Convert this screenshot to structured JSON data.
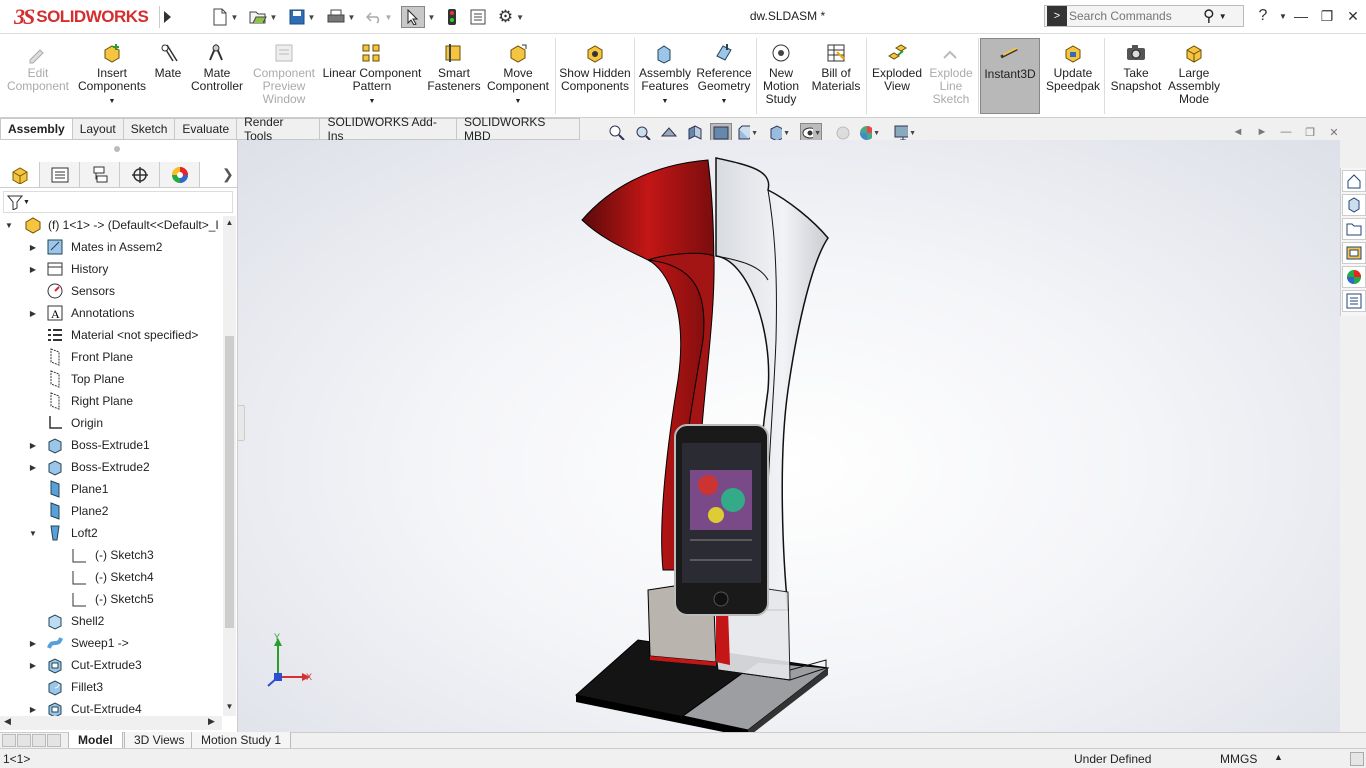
{
  "app": {
    "logo_ds": "3S",
    "logo_text": "SOLIDWORKS",
    "document_title": "dw.SLDASM *",
    "search_placeholder": "Search Commands",
    "help_label": "?",
    "accent_red": "#d42e2e"
  },
  "ribbon": [
    {
      "id": "edit-component",
      "label": "Edit Component",
      "icon": "edit-component-icon",
      "disabled": true
    },
    {
      "id": "insert-components",
      "label": "Insert Components",
      "icon": "insert-components-icon",
      "dropdown": true
    },
    {
      "id": "mate",
      "label": "Mate",
      "icon": "mate-icon"
    },
    {
      "id": "mate-controller",
      "label": "Mate Controller",
      "icon": "mate-controller-icon"
    },
    {
      "id": "component-preview-window",
      "label": "Component Preview Window",
      "icon": "component-preview-icon",
      "disabled": true
    },
    {
      "id": "linear-component-pattern",
      "label": "Linear Component Pattern",
      "icon": "linear-pattern-icon",
      "dropdown": true
    },
    {
      "id": "smart-fasteners",
      "label": "Smart Fasteners",
      "icon": "smart-fasteners-icon"
    },
    {
      "id": "move-component",
      "label": "Move Component",
      "icon": "move-component-icon",
      "dropdown": true
    },
    {
      "id": "show-hidden-components",
      "label": "Show Hidden Components",
      "icon": "show-hidden-icon"
    },
    {
      "id": "assembly-features",
      "label": "Assembly Features",
      "icon": "assembly-features-icon",
      "dropdown": true
    },
    {
      "id": "reference-geometry",
      "label": "Reference Geometry",
      "icon": "reference-geometry-icon",
      "dropdown": true
    },
    {
      "id": "new-motion-study",
      "label": "New Motion Study",
      "icon": "motion-study-icon"
    },
    {
      "id": "bill-of-materials",
      "label": "Bill of Materials",
      "icon": "bill-of-materials-icon"
    },
    {
      "id": "exploded-view",
      "label": "Exploded View",
      "icon": "exploded-view-icon"
    },
    {
      "id": "explode-line-sketch",
      "label": "Explode Line Sketch",
      "icon": "explode-line-sketch-icon",
      "disabled": true
    },
    {
      "id": "instant3d",
      "label": "Instant3D",
      "icon": "instant3d-icon",
      "active": true
    },
    {
      "id": "update-speedpak",
      "label": "Update Speedpak",
      "icon": "speedpak-icon"
    },
    {
      "id": "take-snapshot",
      "label": "Take Snapshot",
      "icon": "camera-icon"
    },
    {
      "id": "large-assembly-mode",
      "label": "Large Assembly Mode",
      "icon": "large-assembly-icon"
    }
  ],
  "tabs": [
    "Assembly",
    "Layout",
    "Sketch",
    "Evaluate",
    "Render Tools",
    "SOLIDWORKS Add-Ins",
    "SOLIDWORKS MBD"
  ],
  "active_tab": "Assembly",
  "tree": [
    {
      "label": "(f) 1<1> -> (Default<<Default>_I",
      "icon": "assembly-icon",
      "expander": "down",
      "indent": 0
    },
    {
      "label": "Mates in Assem2",
      "icon": "mates-icon",
      "expander": "right",
      "indent": 1
    },
    {
      "label": "History",
      "icon": "history-icon",
      "expander": "right",
      "indent": 1
    },
    {
      "label": "Sensors",
      "icon": "sensors-icon",
      "expander": "",
      "indent": 1
    },
    {
      "label": "Annotations",
      "icon": "annotations-icon",
      "expander": "right",
      "indent": 1
    },
    {
      "label": "Material <not specified>",
      "icon": "material-icon",
      "expander": "",
      "indent": 1
    },
    {
      "label": "Front Plane",
      "icon": "plane-icon",
      "expander": "",
      "indent": 1
    },
    {
      "label": "Top Plane",
      "icon": "plane-icon",
      "expander": "",
      "indent": 1
    },
    {
      "label": "Right Plane",
      "icon": "plane-icon",
      "expander": "",
      "indent": 1
    },
    {
      "label": "Origin",
      "icon": "origin-icon",
      "expander": "",
      "indent": 1
    },
    {
      "label": "Boss-Extrude1",
      "icon": "extrude-icon",
      "expander": "right",
      "indent": 1
    },
    {
      "label": "Boss-Extrude2",
      "icon": "extrude-icon",
      "expander": "right",
      "indent": 1
    },
    {
      "label": "Plane1",
      "icon": "plane-solid-icon",
      "expander": "",
      "indent": 1
    },
    {
      "label": "Plane2",
      "icon": "plane-solid-icon",
      "expander": "",
      "indent": 1
    },
    {
      "label": "Loft2",
      "icon": "loft-icon",
      "expander": "down",
      "indent": 1
    },
    {
      "label": "(-) Sketch3",
      "icon": "sketch-icon",
      "expander": "",
      "indent": 2
    },
    {
      "label": "(-) Sketch4",
      "icon": "sketch-icon",
      "expander": "",
      "indent": 2
    },
    {
      "label": "(-) Sketch5",
      "icon": "sketch-icon",
      "expander": "",
      "indent": 2
    },
    {
      "label": "Shell2",
      "icon": "shell-icon",
      "expander": "",
      "indent": 1
    },
    {
      "label": "Sweep1 ->",
      "icon": "sweep-icon",
      "expander": "right",
      "indent": 1
    },
    {
      "label": "Cut-Extrude3",
      "icon": "cut-extrude-icon",
      "expander": "right",
      "indent": 1
    },
    {
      "label": "Fillet3",
      "icon": "fillet-icon",
      "expander": "",
      "indent": 1
    },
    {
      "label": "Cut-Extrude4",
      "icon": "cut-extrude-icon",
      "expander": "right",
      "indent": 1
    }
  ],
  "triad": {
    "x_label": "X",
    "y_label": "Y"
  },
  "bottom_tabs": [
    "Model",
    "3D Views",
    "Motion Study 1"
  ],
  "active_bottom_tab": "Model",
  "status": {
    "left": "1<1>",
    "state": "Under Defined",
    "units": "MMGS"
  }
}
